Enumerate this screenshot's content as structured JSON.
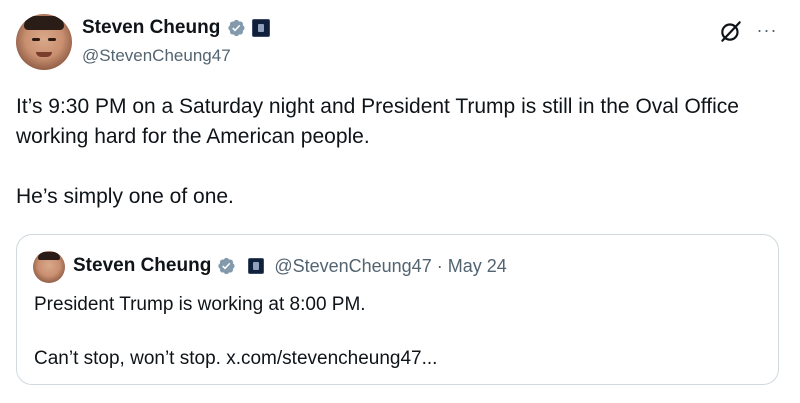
{
  "tweet": {
    "author": {
      "display_name": "Steven Cheung",
      "handle": "@StevenCheung47",
      "verified_icon": "verified-badge-icon",
      "affiliation_icon": "affiliation-badge-icon",
      "verified_color": "#829aab"
    },
    "actions": {
      "grok_icon": "grok-icon",
      "more_icon": "more-icon",
      "more_glyph": "···"
    },
    "text": {
      "line1": "It’s 9:30 PM on a Saturday night and President Trump is still in the Oval Office working hard for the American people.",
      "line2": "He’s simply one of one."
    },
    "quote": {
      "author": {
        "display_name": "Steven Cheung",
        "handle": "@StevenCheung47"
      },
      "separator": "·",
      "date": "May 24",
      "text": {
        "line1": "President Trump is working at 8:00 PM.",
        "line2": "Can’t stop, won’t stop. x.com/stevencheung47..."
      }
    }
  },
  "colors": {
    "text_primary": "#0f1419",
    "text_secondary": "#536471",
    "border": "#cfd9de"
  }
}
